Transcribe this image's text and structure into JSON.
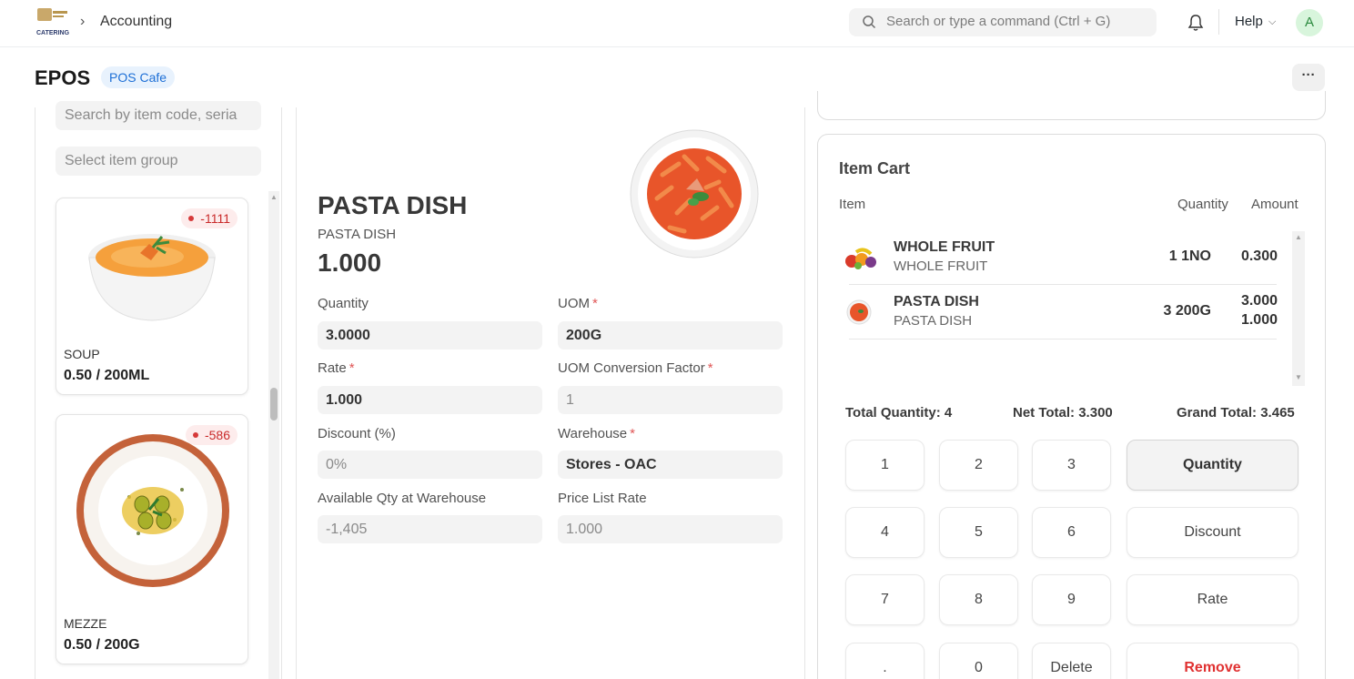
{
  "navbar": {
    "logo_text": "CATERING",
    "breadcrumb": "Accounting",
    "search_placeholder": "Search or type a command (Ctrl + G)",
    "help_label": "Help",
    "avatar_initial": "A"
  },
  "page": {
    "title": "EPOS",
    "profile_pill": "POS Cafe",
    "more_label": "···"
  },
  "item_selector": {
    "search_placeholder": "Search by item code, seria",
    "group_placeholder": "Select item group",
    "items": [
      {
        "name": "SOUP",
        "price": "0.50 / 200ML",
        "stock": "-1111"
      },
      {
        "name": "MEZZE",
        "price": "0.50 / 200G",
        "stock": "-586"
      }
    ]
  },
  "item_details": {
    "title": "PASTA DISH",
    "subtitle": "PASTA DISH",
    "price": "1.000",
    "fields": {
      "quantity": {
        "label": "Quantity",
        "value": "3.0000"
      },
      "uom": {
        "label": "UOM",
        "value": "200G"
      },
      "rate": {
        "label": "Rate",
        "value": "1.000"
      },
      "uom_conversion_factor": {
        "label": "UOM Conversion Factor",
        "value": "1"
      },
      "discount": {
        "label": "Discount (%)",
        "value": "0%"
      },
      "warehouse": {
        "label": "Warehouse",
        "value": "Stores - OAC"
      },
      "available_qty": {
        "label": "Available Qty at Warehouse",
        "value": "-1,405"
      },
      "price_list_rate": {
        "label": "Price List Rate",
        "value": "1.000"
      }
    },
    "required_mark": "*"
  },
  "cart": {
    "title": "Item Cart",
    "headers": {
      "item": "Item",
      "quantity": "Quantity",
      "amount": "Amount"
    },
    "rows": [
      {
        "name": "WHOLE FRUIT",
        "desc": "WHOLE FRUIT",
        "qty": "1 1NO",
        "amount": "0.300",
        "amount_sub": ""
      },
      {
        "name": "PASTA DISH",
        "desc": "PASTA DISH",
        "qty": "3 200G",
        "amount": "3.000",
        "amount_sub": "1.000"
      }
    ],
    "totals": {
      "total_quantity": "Total Quantity: 4",
      "net_total": "Net Total: 3.300",
      "grand_total": "Grand Total: 3.465"
    },
    "keypad": {
      "k1": "1",
      "k2": "2",
      "k3": "3",
      "k4": "4",
      "k5": "5",
      "k6": "6",
      "k7": "7",
      "k8": "8",
      "k9": "9",
      "kdot": ".",
      "k0": "0",
      "kdel": "Delete",
      "quantity": "Quantity",
      "discount": "Discount",
      "rate": "Rate",
      "remove": "Remove"
    }
  },
  "colors": {
    "accent_blue": "#1d6fd6",
    "danger_red": "#e03131",
    "avatar_green": "#2b8a3e"
  }
}
